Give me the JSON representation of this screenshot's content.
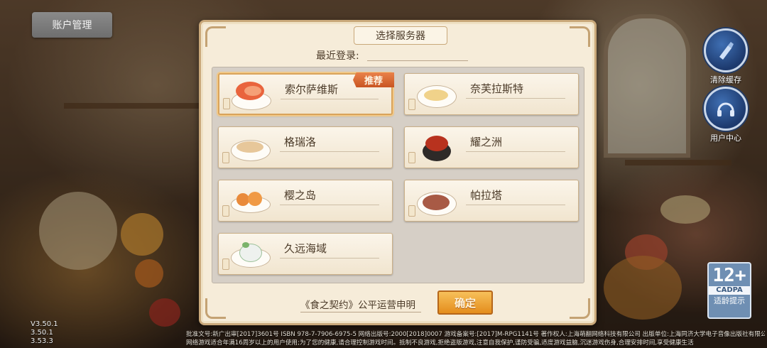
{
  "account": {
    "label": "账户管理"
  },
  "side": {
    "clear_cache": "清除缓存",
    "user_center": "用户中心"
  },
  "age_rating": {
    "number": "12+",
    "org": "CADPA",
    "text": "适龄提示"
  },
  "versions": [
    "V3.50.1",
    "3.50.1",
    "3.53.3"
  ],
  "legal": {
    "line1": "批准文号:新广出审[2017]3601号 ISBN 978-7-7906-6975-5 网络出版号:2000[2018]0007 游戏备案号:[2017]M-RPG1141号 著作权人:上海萌翻网络科技有限公司 出版单位:上海同济大学电子音像出版社有限公司",
    "line2": "网络游戏适合年满16周岁以上的用户使用;为了您的健康,请合理控制游戏时间。抵制不良游戏,拒绝盗版游戏,注意自我保护,谨防受骗,适度游戏益脑,沉迷游戏伤身,合理安排时间,享受健康生活"
  },
  "dialog": {
    "title": "选择服务器",
    "recent_label": "最近登录:",
    "recent_value": "",
    "recommend_badge": "推荐",
    "fair_text": "《食之契约》公平运营申明",
    "confirm_label": "确定",
    "servers": [
      {
        "name": "索尔萨维斯",
        "selected": true,
        "recommended": true
      },
      {
        "name": "奈芙拉斯特",
        "selected": false,
        "recommended": false
      },
      {
        "name": "格瑞洛",
        "selected": false,
        "recommended": false
      },
      {
        "name": "耀之洲",
        "selected": false,
        "recommended": false
      },
      {
        "name": "樱之岛",
        "selected": false,
        "recommended": false
      },
      {
        "name": "帕拉塔",
        "selected": false,
        "recommended": false
      },
      {
        "name": "久远海域",
        "selected": false,
        "recommended": false
      }
    ]
  },
  "colors": {
    "accent": "#e48d1c",
    "badge": "#c95522",
    "panel": "#f6ecd9"
  }
}
